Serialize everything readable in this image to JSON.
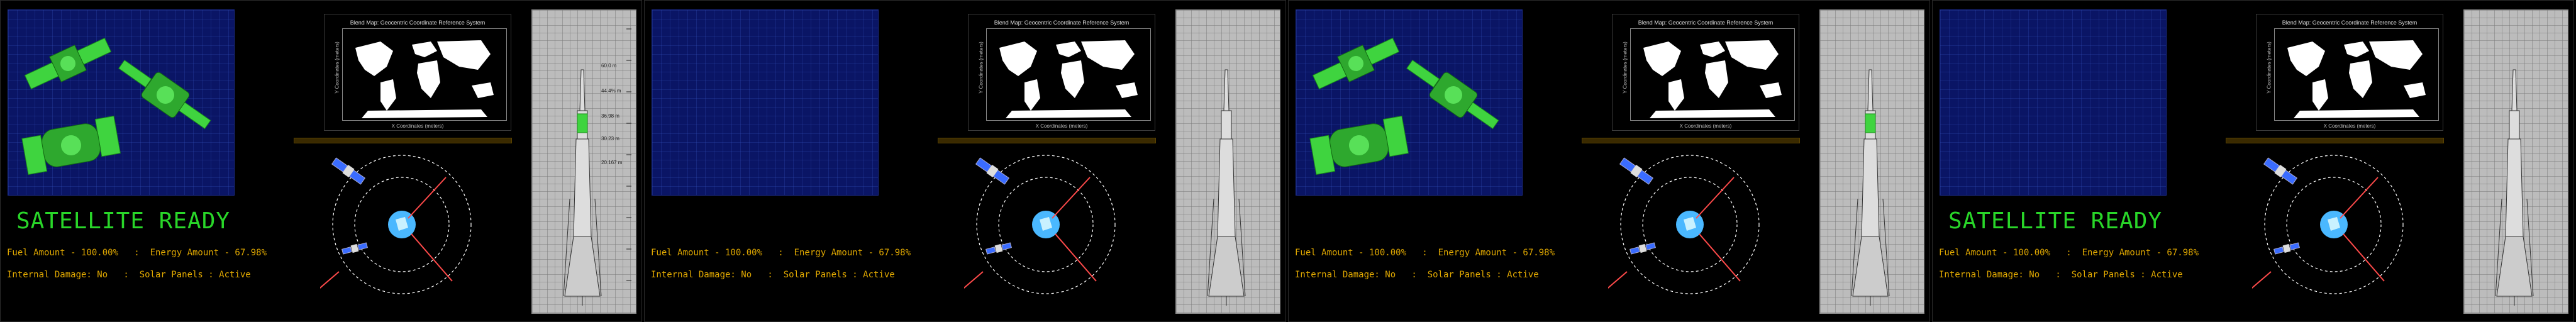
{
  "panels": [
    {
      "show_satellites": true,
      "status_title": "SATELLITE READY",
      "stage_highlight": true
    },
    {
      "show_satellites": false,
      "status_title": "",
      "stage_highlight": false
    },
    {
      "show_satellites": true,
      "status_title": "",
      "stage_highlight": true
    },
    {
      "show_satellites": false,
      "status_title": "SATELLITE READY",
      "stage_highlight": false
    }
  ],
  "stats": {
    "line1": "Fuel Amount - 100.00%   :  Energy Amount - 67.98%",
    "line2": "Internal Damage: No   :  Solar Panels : Active"
  },
  "map": {
    "title": "Blend Map: Geocentric Coordinate Reference System",
    "xlabel": "X Coordinates (meters)",
    "ylabel": "Y Coordinates (meters)"
  },
  "altitudes": [
    "60.0 m",
    "44.4% m",
    "36.98 m",
    "30.23 m",
    "20.167 m"
  ],
  "colors": {
    "sat_bg": "#0a1565",
    "status_green": "#29d629",
    "stat_amber": "#e0a800",
    "orbit": "#ffffff",
    "vector": "#ff4a4a",
    "earth": "#4ab8ff"
  },
  "icons": [
    "satellite-icon",
    "earth-icon",
    "rocket-icon"
  ]
}
